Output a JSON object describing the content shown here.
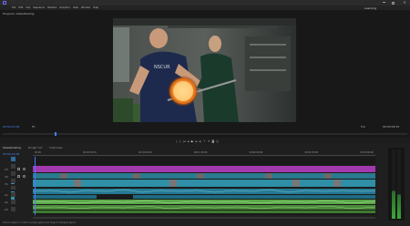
{
  "window": {
    "title": "Adobe Premiere Pro",
    "workspace_label": "Learning"
  },
  "menu": [
    "File",
    "Edit",
    "Clip",
    "Sequence",
    "Markers",
    "Graphics",
    "View",
    "Window",
    "Help"
  ],
  "monitor": {
    "panel_label": "Program: Glassblowing",
    "timecode_left": "00:00:14:08",
    "timecode_right": "00:03:09:15",
    "fit_label": "Fit",
    "quality_label": "Full"
  },
  "sequence_tabs": [
    {
      "label": "Glassblowing"
    },
    {
      "label": "Rough Cut"
    },
    {
      "label": "Interview"
    }
  ],
  "timeline": {
    "timecode": "00:00:14:08",
    "ruler_labels": [
      "00:00",
      "00:00:30:00",
      "00:01:00:00",
      "00:01:30:00",
      "00:02:00:00",
      "00:02:30:00",
      "00:03:00:00"
    ],
    "tracks": [
      {
        "name": "V3",
        "color": "#b83cb8"
      },
      {
        "name": "V2",
        "color": "#3aa7b9"
      },
      {
        "name": "V1",
        "color": "#3aa7b9"
      },
      {
        "name": "A1",
        "color": "#4a8a3a"
      },
      {
        "name": "A2",
        "color": "#4a8a3a"
      },
      {
        "name": "A3",
        "color": "#3aa7b9"
      }
    ]
  },
  "status_bar": {
    "text": "Click to select, or click in empty space and drag to marquee select."
  },
  "colors": {
    "purple_clip": "#b040b8",
    "teal_clip": "#2f8fa6",
    "green_audio": "#5aa84a",
    "playhead": "#4a7cff"
  }
}
